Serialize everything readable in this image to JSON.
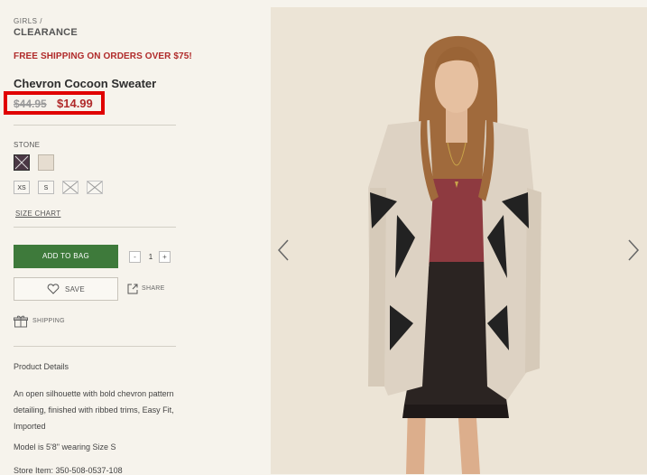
{
  "breadcrumb": {
    "parent": "GIRLS",
    "separator": "/",
    "current": "CLEARANCE"
  },
  "promo": "FREE SHIPPING ON ORDERS OVER $75!",
  "product": {
    "name": "Chevron Cocoon Sweater",
    "original_price": "$44.95",
    "sale_price": "$14.99"
  },
  "color": {
    "label": "STONE",
    "swatches": [
      {
        "name": "dark",
        "hex": "#4a3744",
        "available": false
      },
      {
        "name": "stone",
        "hex": "#e6ddd0",
        "available": true
      }
    ]
  },
  "sizes": [
    {
      "label": "XS",
      "available": true
    },
    {
      "label": "S",
      "available": true
    },
    {
      "label": "",
      "available": false
    },
    {
      "label": "",
      "available": false
    }
  ],
  "size_chart": "SIZE CHART",
  "actions": {
    "add_to_bag": "ADD TO BAG",
    "quantity": "1",
    "minus": "-",
    "plus": "+",
    "save": "SAVE",
    "share": "SHARE",
    "shipping": "SHIPPING"
  },
  "details": {
    "heading": "Product Details",
    "description": "An open silhouette with bold chevron pattern detailing, finished with ribbed trims, Easy Fit, Imported",
    "model": "Model is 5'8\" wearing Size S",
    "store_item": "Store Item: 350-508-0537-108"
  },
  "colors": {
    "accent_red": "#b02a2a",
    "highlight_box": "#e00000",
    "add_to_bag_green": "#3e7a3b",
    "background": "#f6f3ec"
  }
}
